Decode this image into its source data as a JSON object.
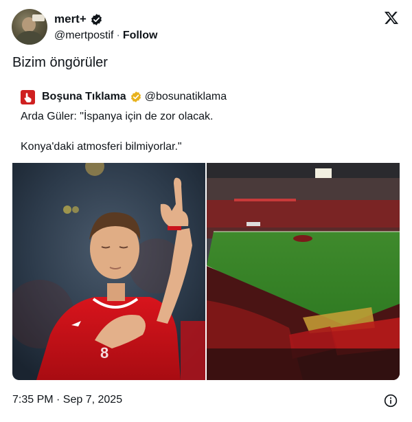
{
  "author": {
    "display_name": "mert+",
    "handle": "@mertpostif",
    "separator": "·",
    "follow_label": "Follow",
    "avatar_icon": "user-avatar-photo",
    "verified_icon": "verified-badge-icon",
    "verified_color": "#0f1419"
  },
  "platform_icon": "x-logo-icon",
  "tweet": {
    "text": "Bizim öngörüler"
  },
  "quoted": {
    "logo_icon": "hand-pointer-logo-icon",
    "logo_color": "#cf2020",
    "name": "Boşuna Tıklama",
    "verified_icon": "gold-verified-badge-icon",
    "verified_color": "#e8b21d",
    "handle": "@bosunatiklama",
    "line1": "Arda Güler: \"İspanya için de zor olacak.",
    "line2": "Konya'daki atmosferi bilmiyorlar.\"",
    "images": [
      {
        "name": "player-pointing-up-photo"
      },
      {
        "name": "stadium-crowd-photo"
      }
    ]
  },
  "footer": {
    "timestamp": "7:35 PM · Sep 7, 2025",
    "info_icon": "info-icon"
  }
}
